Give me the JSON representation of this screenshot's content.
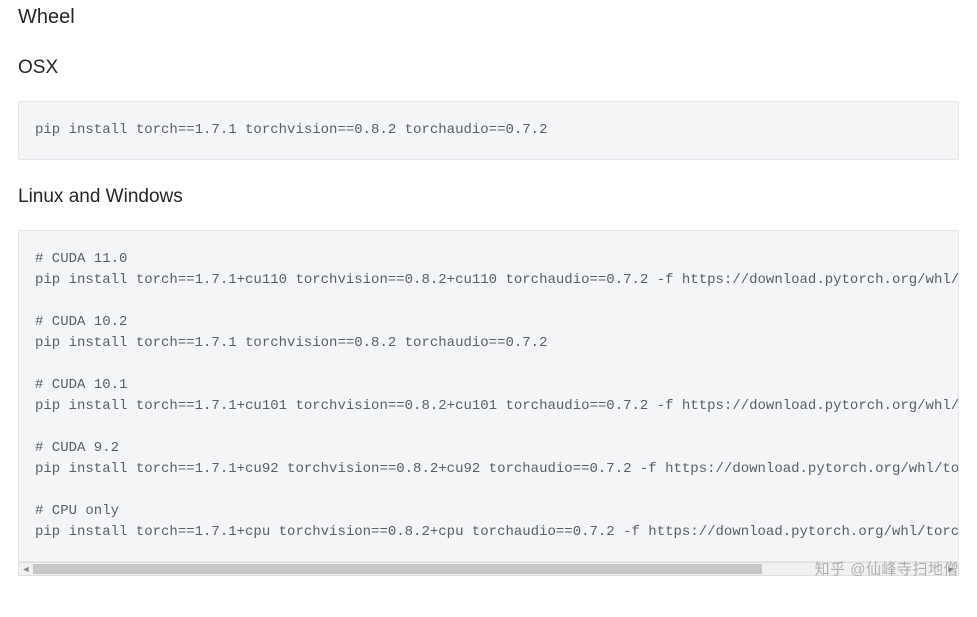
{
  "headings": {
    "wheel": "Wheel",
    "osx": "OSX",
    "linux_windows": "Linux and Windows"
  },
  "code": {
    "osx": "pip install torch==1.7.1 torchvision==0.8.2 torchaudio==0.7.2",
    "linux_windows": "# CUDA 11.0\npip install torch==1.7.1+cu110 torchvision==0.8.2+cu110 torchaudio==0.7.2 -f https://download.pytorch.org/whl/torch_stable.html\n\n# CUDA 10.2\npip install torch==1.7.1 torchvision==0.8.2 torchaudio==0.7.2\n\n# CUDA 10.1\npip install torch==1.7.1+cu101 torchvision==0.8.2+cu101 torchaudio==0.7.2 -f https://download.pytorch.org/whl/torch_stable.html\n\n# CUDA 9.2\npip install torch==1.7.1+cu92 torchvision==0.8.2+cu92 torchaudio==0.7.2 -f https://download.pytorch.org/whl/torch_stable.html\n\n# CPU only\npip install torch==1.7.1+cpu torchvision==0.8.2+cpu torchaudio==0.7.2 -f https://download.pytorch.org/whl/torch_stable.html"
  },
  "scrollbar": {
    "left_arrow": "◄",
    "right_arrow": "►"
  },
  "watermark": "知乎 @仙峰寺扫地僧"
}
